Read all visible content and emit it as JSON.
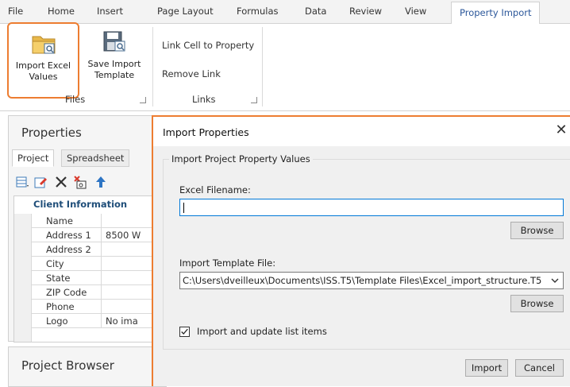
{
  "ribbon_tabs": [
    "File",
    "Home",
    "Insert",
    "Page Layout",
    "Formulas",
    "Data",
    "Review",
    "View",
    "Property Import"
  ],
  "active_tab": "Property Import",
  "ribbon": {
    "files_group": {
      "label": "Files",
      "import_excel": "Import Excel Values",
      "save_template": "Save Import Template"
    },
    "links_group": {
      "label": "Links",
      "link_cell": "Link Cell to Property",
      "remove_link": "Remove Link"
    }
  },
  "properties": {
    "title": "Properties",
    "tabs": [
      "Project",
      "Spreadsheet"
    ],
    "category": "Client Information",
    "rows": [
      {
        "key": "Name",
        "value": ""
      },
      {
        "key": "Address 1",
        "value": "8500 W"
      },
      {
        "key": "Address 2",
        "value": ""
      },
      {
        "key": "City",
        "value": ""
      },
      {
        "key": "State",
        "value": ""
      },
      {
        "key": "ZIP Code",
        "value": ""
      },
      {
        "key": "Phone",
        "value": ""
      },
      {
        "key": "Logo",
        "value": "No ima"
      }
    ]
  },
  "project_browser": {
    "title": "Project Browser"
  },
  "dialog": {
    "title": "Import Properties",
    "group_label": "Import Project Property Values",
    "excel_label": "Excel Filename:",
    "excel_value": "",
    "browse": "Browse",
    "template_label": "Import Template File:",
    "template_value": "C:\\Users\\dveilleux\\Documents\\ISS.T5\\Template Files\\Excel_import_structure.T5",
    "checkbox_label": "Import and update list items",
    "checkbox_checked": true,
    "import_button": "Import",
    "cancel_button": "Cancel"
  },
  "colors": {
    "highlight": "#ed7d31",
    "accent": "#2b579a",
    "focus": "#0078d7"
  }
}
